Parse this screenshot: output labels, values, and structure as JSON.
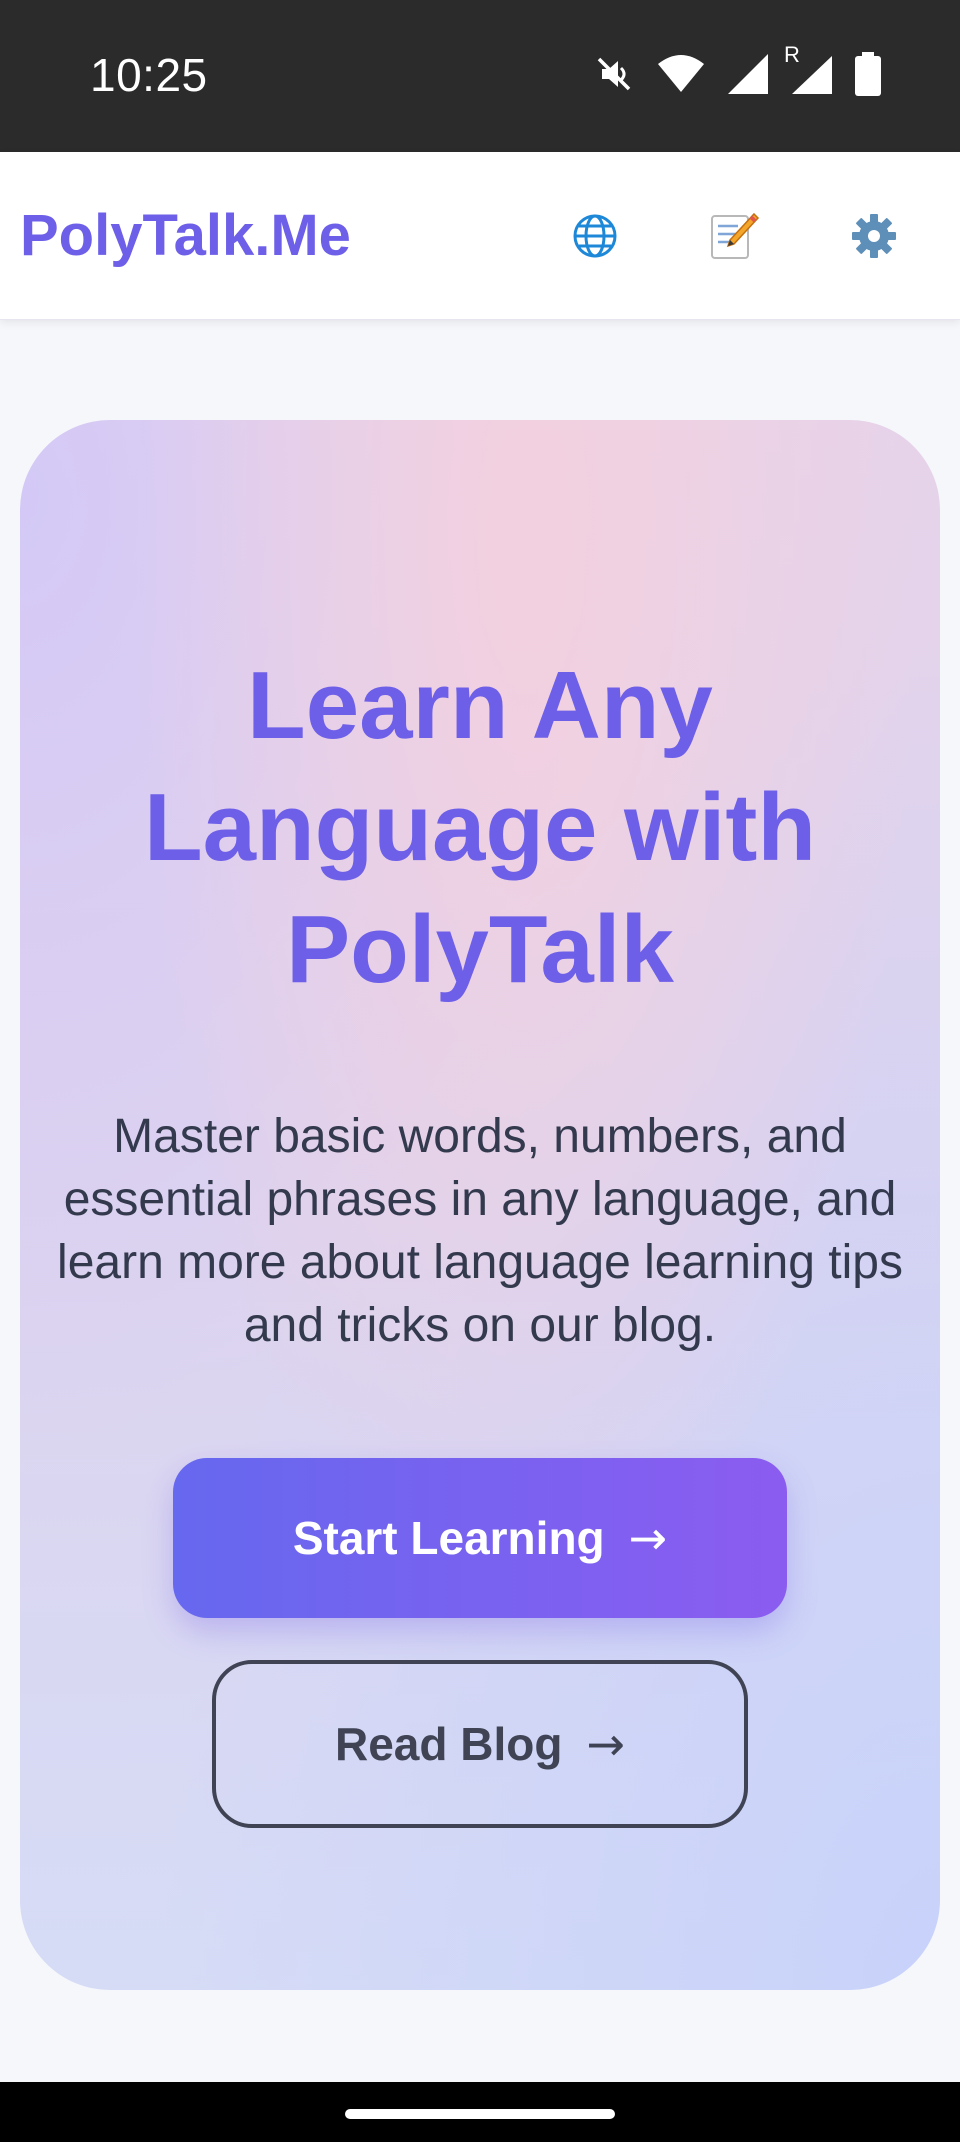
{
  "status_bar": {
    "time": "10:25",
    "icons": [
      "mute-icon",
      "wifi-icon",
      "signal-icon",
      "roaming-signal-icon",
      "battery-icon"
    ],
    "roaming_label": "R"
  },
  "header": {
    "brand": "PolyTalk.Me",
    "icons": [
      {
        "name": "globe-icon",
        "glyph": "🌐"
      },
      {
        "name": "memo-icon",
        "glyph": "📝"
      },
      {
        "name": "gear-icon",
        "glyph": "⚙️"
      }
    ]
  },
  "hero": {
    "title": "Learn Any Language with PolyTalk",
    "description": "Master basic words, numbers, and essential phrases in any language, and learn more about language learning tips and tricks on our blog.",
    "primary_button": {
      "label": "Start Learning",
      "arrow": "→"
    },
    "secondary_button": {
      "label": "Read Blog",
      "arrow": "→"
    }
  },
  "colors": {
    "brand": "#6d5fe8",
    "primary_gradient_start": "#6668ef",
    "primary_gradient_end": "#8b5cf0",
    "text_dark": "#343a4e"
  }
}
